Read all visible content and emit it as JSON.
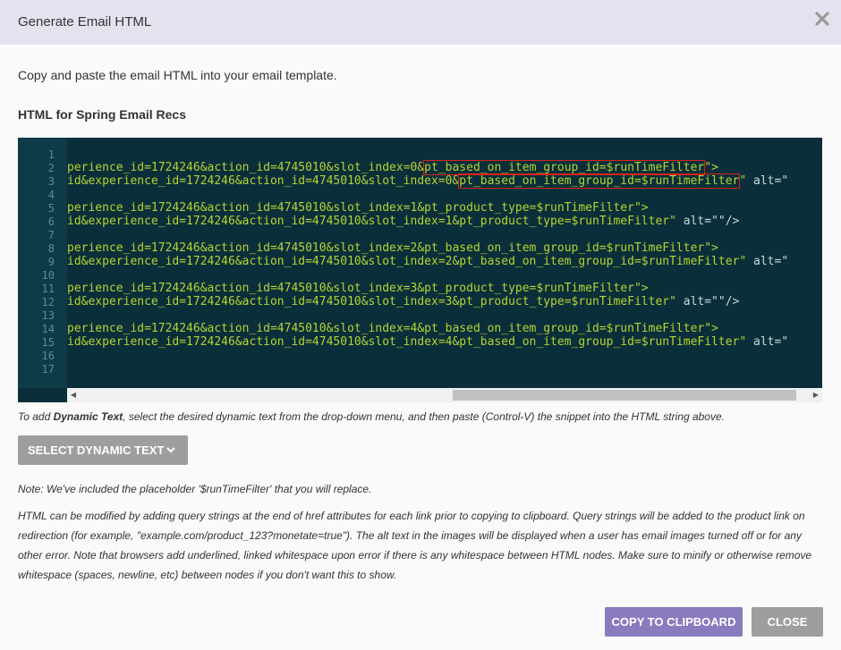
{
  "dialog": {
    "title": "Generate Email HTML",
    "close_icon": "close-icon"
  },
  "intro_text": "Copy and paste the email HTML into your email template.",
  "section_title": "HTML for Spring Email Recs",
  "code": {
    "line_numbers": [
      "1",
      "2",
      "3",
      "4",
      "5",
      "6",
      "7",
      "8",
      "9",
      "10",
      "11",
      "12",
      "13",
      "14",
      "15",
      "16",
      "17"
    ],
    "lines": {
      "l2_a": "perience_id=1724246&action_id=4745010&slot_index=0&",
      "l2_b": "pt_based_on_item_group_id=$runTimeFilter",
      "l2_c": "\">",
      "l3_a": "id&experience_id=1724246&action_id=4745010&slot_index=0&",
      "l3_b": "pt_based_on_item_group_id=$runTimeFilter",
      "l3_c": "\" ",
      "l3_d": "alt=\"",
      "l5": "perience_id=1724246&action_id=4745010&slot_index=1&pt_product_type=$runTimeFilter\">",
      "l6_a": "id&experience_id=1724246&action_id=4745010&slot_index=1&pt_product_type=$runTimeFilter\" ",
      "l6_b": "alt=\"\"/>",
      "l8": "perience_id=1724246&action_id=4745010&slot_index=2&pt_based_on_item_group_id=$runTimeFilter\">",
      "l9_a": "id&experience_id=1724246&action_id=4745010&slot_index=2&pt_based_on_item_group_id=$runTimeFilter\" ",
      "l9_b": "alt=\"",
      "l11": "perience_id=1724246&action_id=4745010&slot_index=3&pt_product_type=$runTimeFilter\">",
      "l12_a": "id&experience_id=1724246&action_id=4745010&slot_index=3&pt_product_type=$runTimeFilter\" ",
      "l12_b": "alt=\"\"/>",
      "l14": "perience_id=1724246&action_id=4745010&slot_index=4&pt_based_on_item_group_id=$runTimeFilter\">",
      "l15_a": "id&experience_id=1724246&action_id=4745010&slot_index=4&pt_based_on_item_group_id=$runTimeFilter\" ",
      "l15_b": "alt=\""
    },
    "scroll_left_icon": "arrow-left-icon",
    "scroll_right_icon": "arrow-right-icon"
  },
  "hint": {
    "prefix": "To add ",
    "bold": "Dynamic Text",
    "suffix": ", select the desired dynamic text from the drop-down menu, and then paste (Control-V) the snippet into the HTML string above."
  },
  "dynamic_button": {
    "label": "SELECT DYNAMIC TEXT",
    "icon": "chevron-down-icon"
  },
  "note": "Note: We've included the placeholder '$runTimeFilter' that you will replace.",
  "paragraph": "HTML can be modified by adding query strings at the end of href attributes for each link prior to copying to clipboard. Query strings will be added to the product link on redirection (for example, \"example.com/product_123?monetate=true\"). The alt text in the images will be displayed when a user has email images turned off or for any other error. Note that browsers add underlined, linked whitespace upon error if there is any whitespace between HTML nodes. Make sure to minify or otherwise remove whitespace (spaces, newline, etc) between nodes if you don't want this to show.",
  "footer": {
    "copy_label": "COPY TO CLIPBOARD",
    "close_label": "CLOSE"
  },
  "colors": {
    "header_bg": "#e5e1ef",
    "code_bg": "#0b2f3a",
    "code_text": "#b5d334",
    "highlight_border": "#d9241b",
    "primary_button": "#8a7bbf",
    "secondary_button": "#9e9e9e"
  }
}
